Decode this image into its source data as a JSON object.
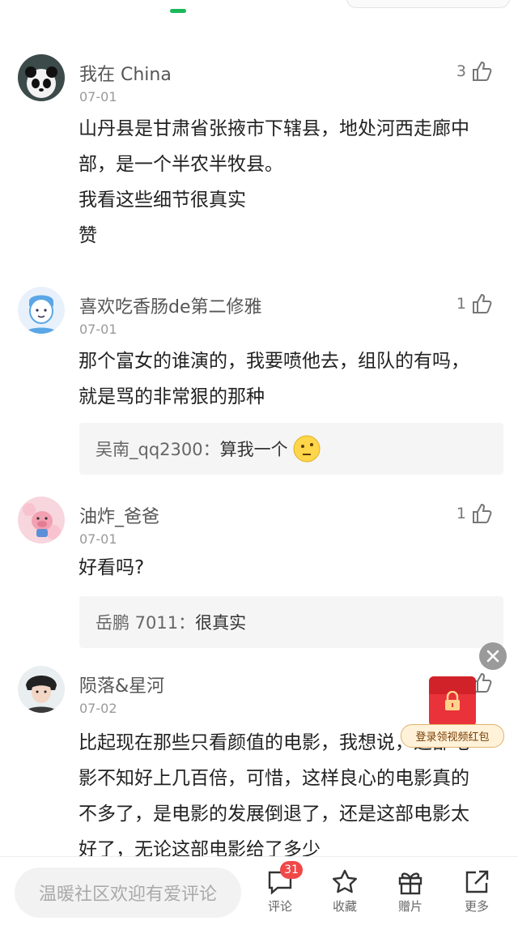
{
  "comments": [
    {
      "author": "我在 China",
      "date": "07-01",
      "likes": "3",
      "lines": [
        "山丹县是甘肃省张掖市下辖县，地处河西走廊中部，是一个半农半牧县。",
        "我看这些细节很真实",
        "赞"
      ]
    },
    {
      "author": "喜欢吃香肠de第二修雅",
      "date": "07-01",
      "likes": "1",
      "lines": [
        "那个富女的谁演的，我要喷他去，组队的有吗，就是骂的非常狠的那种"
      ],
      "reply": {
        "author": "吴南_qq2300：",
        "text": "算我一个",
        "emoji": "thinking-emoji"
      }
    },
    {
      "author": "油炸_爸爸",
      "date": "07-01",
      "likes": "1",
      "lines": [
        "好看吗?"
      ],
      "reply": {
        "author": "岳鹏 7011：",
        "text": "很真实"
      }
    },
    {
      "author": "陨落&星河",
      "date": "07-02",
      "likes": "",
      "lines": [
        "比起现在那些只看颜值的电影，我想说，这部电影不知好上几百倍，可惜，这样良心的电影真的不多了，是电影的发展倒退了，还是这部电影太好了，无论这部电影给了多少"
      ]
    }
  ],
  "floating": {
    "redpacket_label": "登录领视频红包",
    "close_icon": "close-icon",
    "redpacket_icon": "lock-icon"
  },
  "bottom": {
    "input_placeholder": "温暖社区欢迎有爱评论",
    "comment_count": "31",
    "actions": [
      {
        "label": "评论",
        "icon": "comment-icon"
      },
      {
        "label": "收藏",
        "icon": "star-icon"
      },
      {
        "label": "赠片",
        "icon": "gift-icon"
      },
      {
        "label": "更多",
        "icon": "share-icon"
      }
    ]
  },
  "colors": {
    "accent": "#1bb85a",
    "badge": "#f04848",
    "redpacket": "#e9323a"
  }
}
